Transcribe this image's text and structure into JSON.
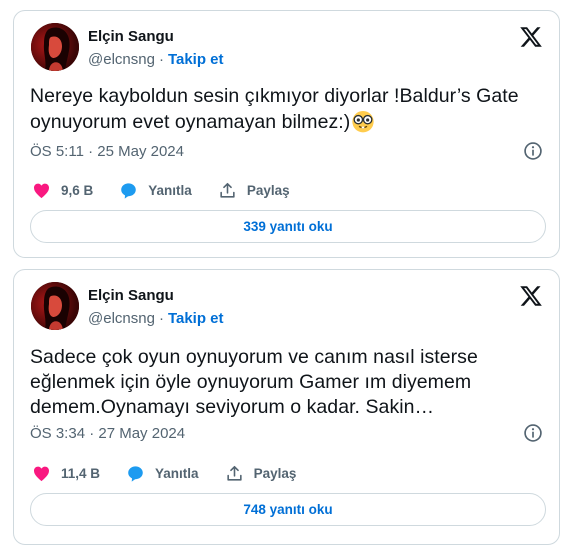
{
  "tweets": [
    {
      "author": "Elçin Sangu",
      "handle": "@elcnsng",
      "separator": "·",
      "follow_label": "Takip et",
      "text": "Nereye kayboldun sesin çıkmıyor diyorlar !Baldur’s Gate oynuyorum evet oynamayan bilmez:)",
      "emoji": "nerd-face-emoji",
      "timestamp": "ÖS 5:11 · 25 May 2024",
      "likes": "9,6 B",
      "reply_label": "Yanıtla",
      "share_label": "Paylaş",
      "read_replies": "339 yanıtı oku"
    },
    {
      "author": "Elçin Sangu",
      "handle": "@elcnsng",
      "separator": "·",
      "follow_label": "Takip et",
      "text": "Sadece çok oyun oynuyorum ve canım nasıl isterse eğlenmek için öyle oynuyorum Gamer ım diyemem demem.Oynamayı seviyorum o kadar. Sakin…",
      "timestamp": "ÖS 3:34 · 27 May 2024",
      "likes": "11,4 B",
      "reply_label": "Yanıtla",
      "share_label": "Paylaş",
      "read_replies": "748 yanıtı oku"
    }
  ],
  "colors": {
    "like": "#f91880",
    "reply": "#1d9bf0",
    "link": "#006fd6",
    "muted": "#536471",
    "border": "#cfd9de"
  },
  "icons": [
    "x-logo-icon",
    "info-icon",
    "heart-icon",
    "reply-bubble-icon",
    "share-icon"
  ]
}
